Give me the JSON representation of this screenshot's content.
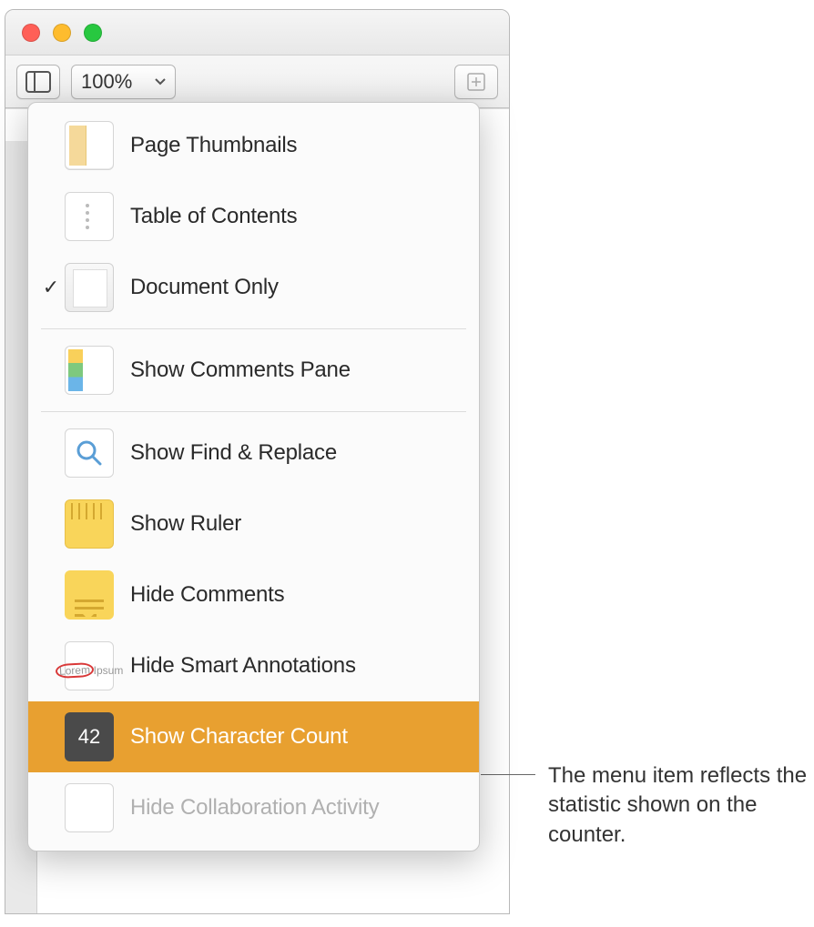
{
  "toolbar": {
    "zoom_level": "100%"
  },
  "menu": {
    "items": {
      "page_thumbnails": "Page Thumbnails",
      "table_of_contents": "Table of Contents",
      "document_only": "Document Only",
      "show_comments_pane": "Show Comments Pane",
      "show_find_replace": "Show Find & Replace",
      "show_ruler": "Show Ruler",
      "hide_comments": "Hide Comments",
      "hide_smart_annotations": "Hide Smart Annotations",
      "show_character_count": "Show Character Count",
      "hide_collaboration_activity": "Hide Collaboration Activity"
    },
    "char_count_badge": "42",
    "checked_item": "document_only",
    "highlighted_item": "show_character_count"
  },
  "annotations": {
    "lorem": "Lorem",
    "ipsum": "Ipsum"
  },
  "callout": {
    "text": "The menu item reflects the statistic shown on the counter."
  }
}
